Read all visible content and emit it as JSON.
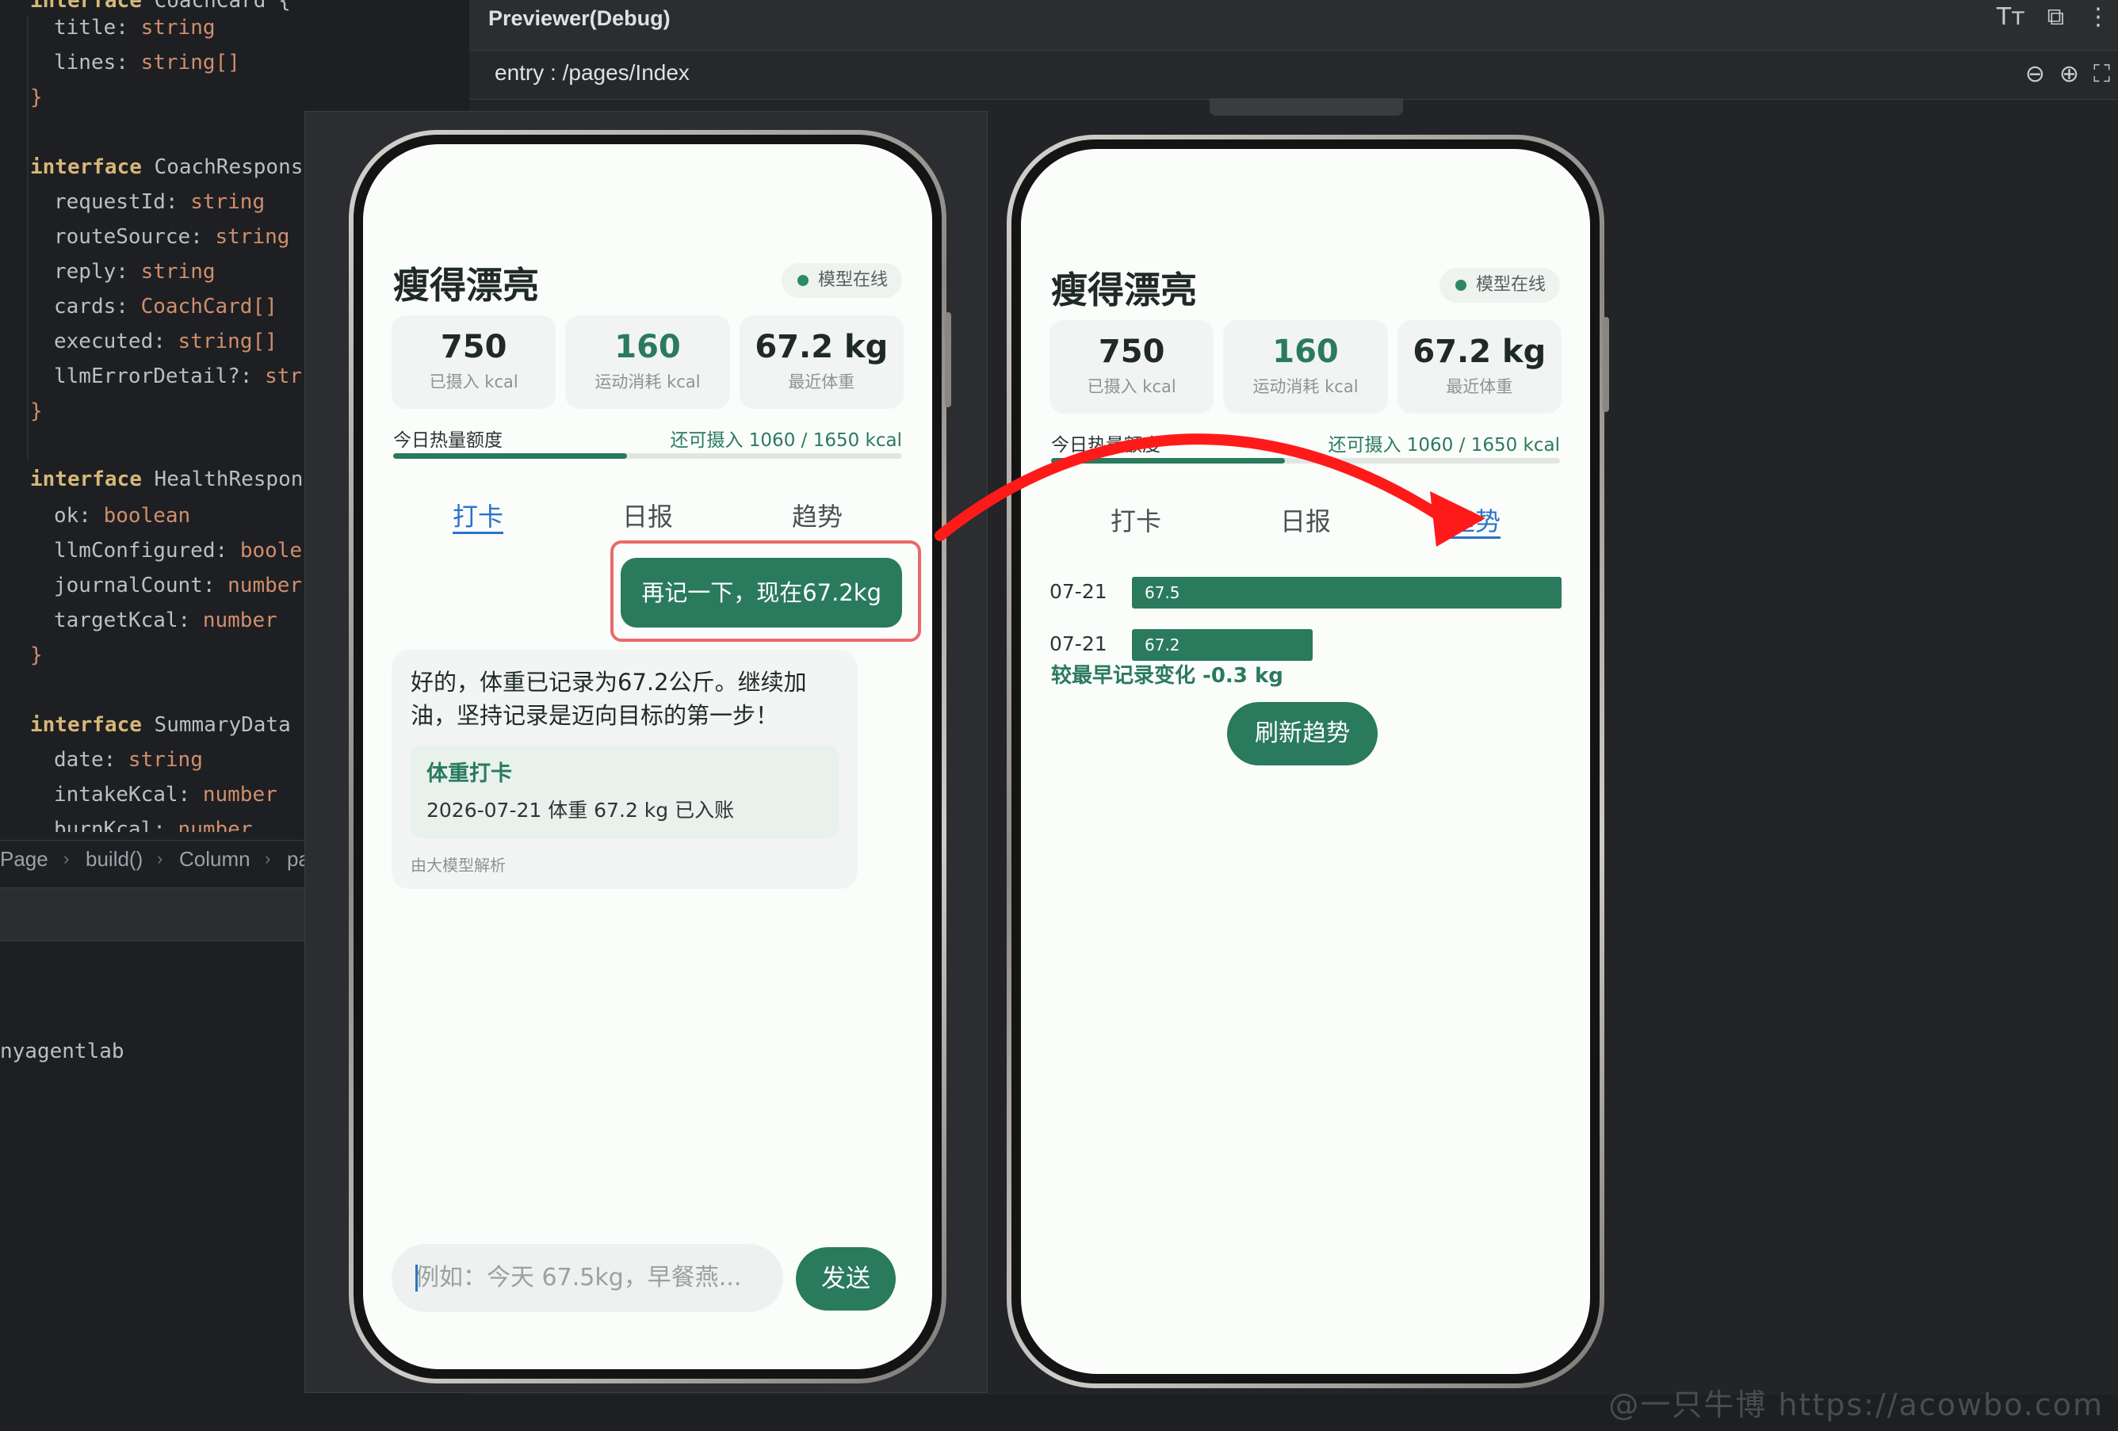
{
  "code": {
    "lines": [
      {
        "t": "kwb",
        "text": "interface",
        "rest": " CoachCard {"
      },
      {
        "t": "field",
        "name": "title",
        "type": "string"
      },
      {
        "t": "field",
        "name": "lines",
        "type": "string[]"
      },
      {
        "t": "close",
        "text": "}"
      },
      {
        "t": "kwb",
        "text": "interface",
        "rest": " CoachResponse"
      },
      {
        "t": "field",
        "name": "requestId",
        "type": "string"
      },
      {
        "t": "field",
        "name": "routeSource",
        "type": "string"
      },
      {
        "t": "field",
        "name": "reply",
        "type": "string"
      },
      {
        "t": "field",
        "name": "cards",
        "type": "CoachCard[]"
      },
      {
        "t": "field",
        "name": "executed",
        "type": "string[]"
      },
      {
        "t": "field",
        "name": "llmErrorDetail?",
        "type": "str"
      },
      {
        "t": "close",
        "text": "}"
      },
      {
        "t": "kwb",
        "text": "interface",
        "rest": " HealthRespon"
      },
      {
        "t": "field",
        "name": "ok",
        "type": "boolean"
      },
      {
        "t": "field",
        "name": "llmConfigured",
        "type": "boole"
      },
      {
        "t": "field",
        "name": "journalCount",
        "type": "number"
      },
      {
        "t": "field",
        "name": "targetKcal",
        "type": "number"
      },
      {
        "t": "close",
        "text": "}"
      },
      {
        "t": "kwb",
        "text": "interface",
        "rest": " SummaryData {"
      },
      {
        "t": "field",
        "name": "date",
        "type": "string"
      },
      {
        "t": "field",
        "name": "intakeKcal",
        "type": "number"
      },
      {
        "t": "field",
        "name": "burnKcal",
        "type": "number"
      }
    ],
    "breadcrumb": [
      "Page",
      "build()",
      "Column",
      "pa"
    ],
    "terminal_text": "nyagentlab"
  },
  "previewer": {
    "title": "Previewer(Debug)",
    "path": "entry : /pages/Index",
    "header_icons": [
      "text-size-icon",
      "collapse-icon",
      "more-icon"
    ],
    "zoom_icons": [
      "zoom-out-icon",
      "zoom-in-icon",
      "fit-window-icon"
    ]
  },
  "watermark": "@一只牛博 https://acowbo.com",
  "app": {
    "title": "瘦得漂亮",
    "badge": "模型在线",
    "stats": [
      {
        "value": "750",
        "label": "已摄入 kcal",
        "accent": false
      },
      {
        "value": "160",
        "label": "运动消耗 kcal",
        "accent": true
      },
      {
        "value": "67.2 kg",
        "label": "最近体重",
        "accent": false
      }
    ],
    "quota_label": "今日热量额度",
    "quota_value": "还可摄入 1060 / 1650 kcal",
    "quota_fraction": 0.46,
    "tabs": [
      "打卡",
      "日报",
      "趋势"
    ]
  },
  "checkin": {
    "active_tab": 0,
    "user_message": "再记一下，现在67.2kg",
    "reply": "好的，体重已记录为67.2公斤。继续加油，坚持记录是迈向目标的第一步！",
    "card_title": "体重打卡",
    "card_line": "2026-07-21 体重 67.2 kg 已入账",
    "parsed_by": "由大模型解析",
    "input_placeholder": "例如：今天 67.5kg，早餐燕...",
    "send_label": "发送"
  },
  "trend": {
    "active_tab": 2,
    "change_text": "较最早记录变化 -0.3 kg",
    "refresh_label": "刷新趋势"
  },
  "chart_data": {
    "type": "bar",
    "categories": [
      "07-21",
      "07-21"
    ],
    "values": [
      67.5,
      67.2
    ],
    "value_labels": [
      "67.5",
      "67.2"
    ],
    "orientation": "horizontal",
    "relative_fill": [
      1.0,
      0.42
    ]
  },
  "colors": {
    "brand": "#2a7a5e",
    "tab_active": "#2a73c9",
    "highlight_border": "#ea6a6a",
    "arrow": "#ff1a1a"
  }
}
